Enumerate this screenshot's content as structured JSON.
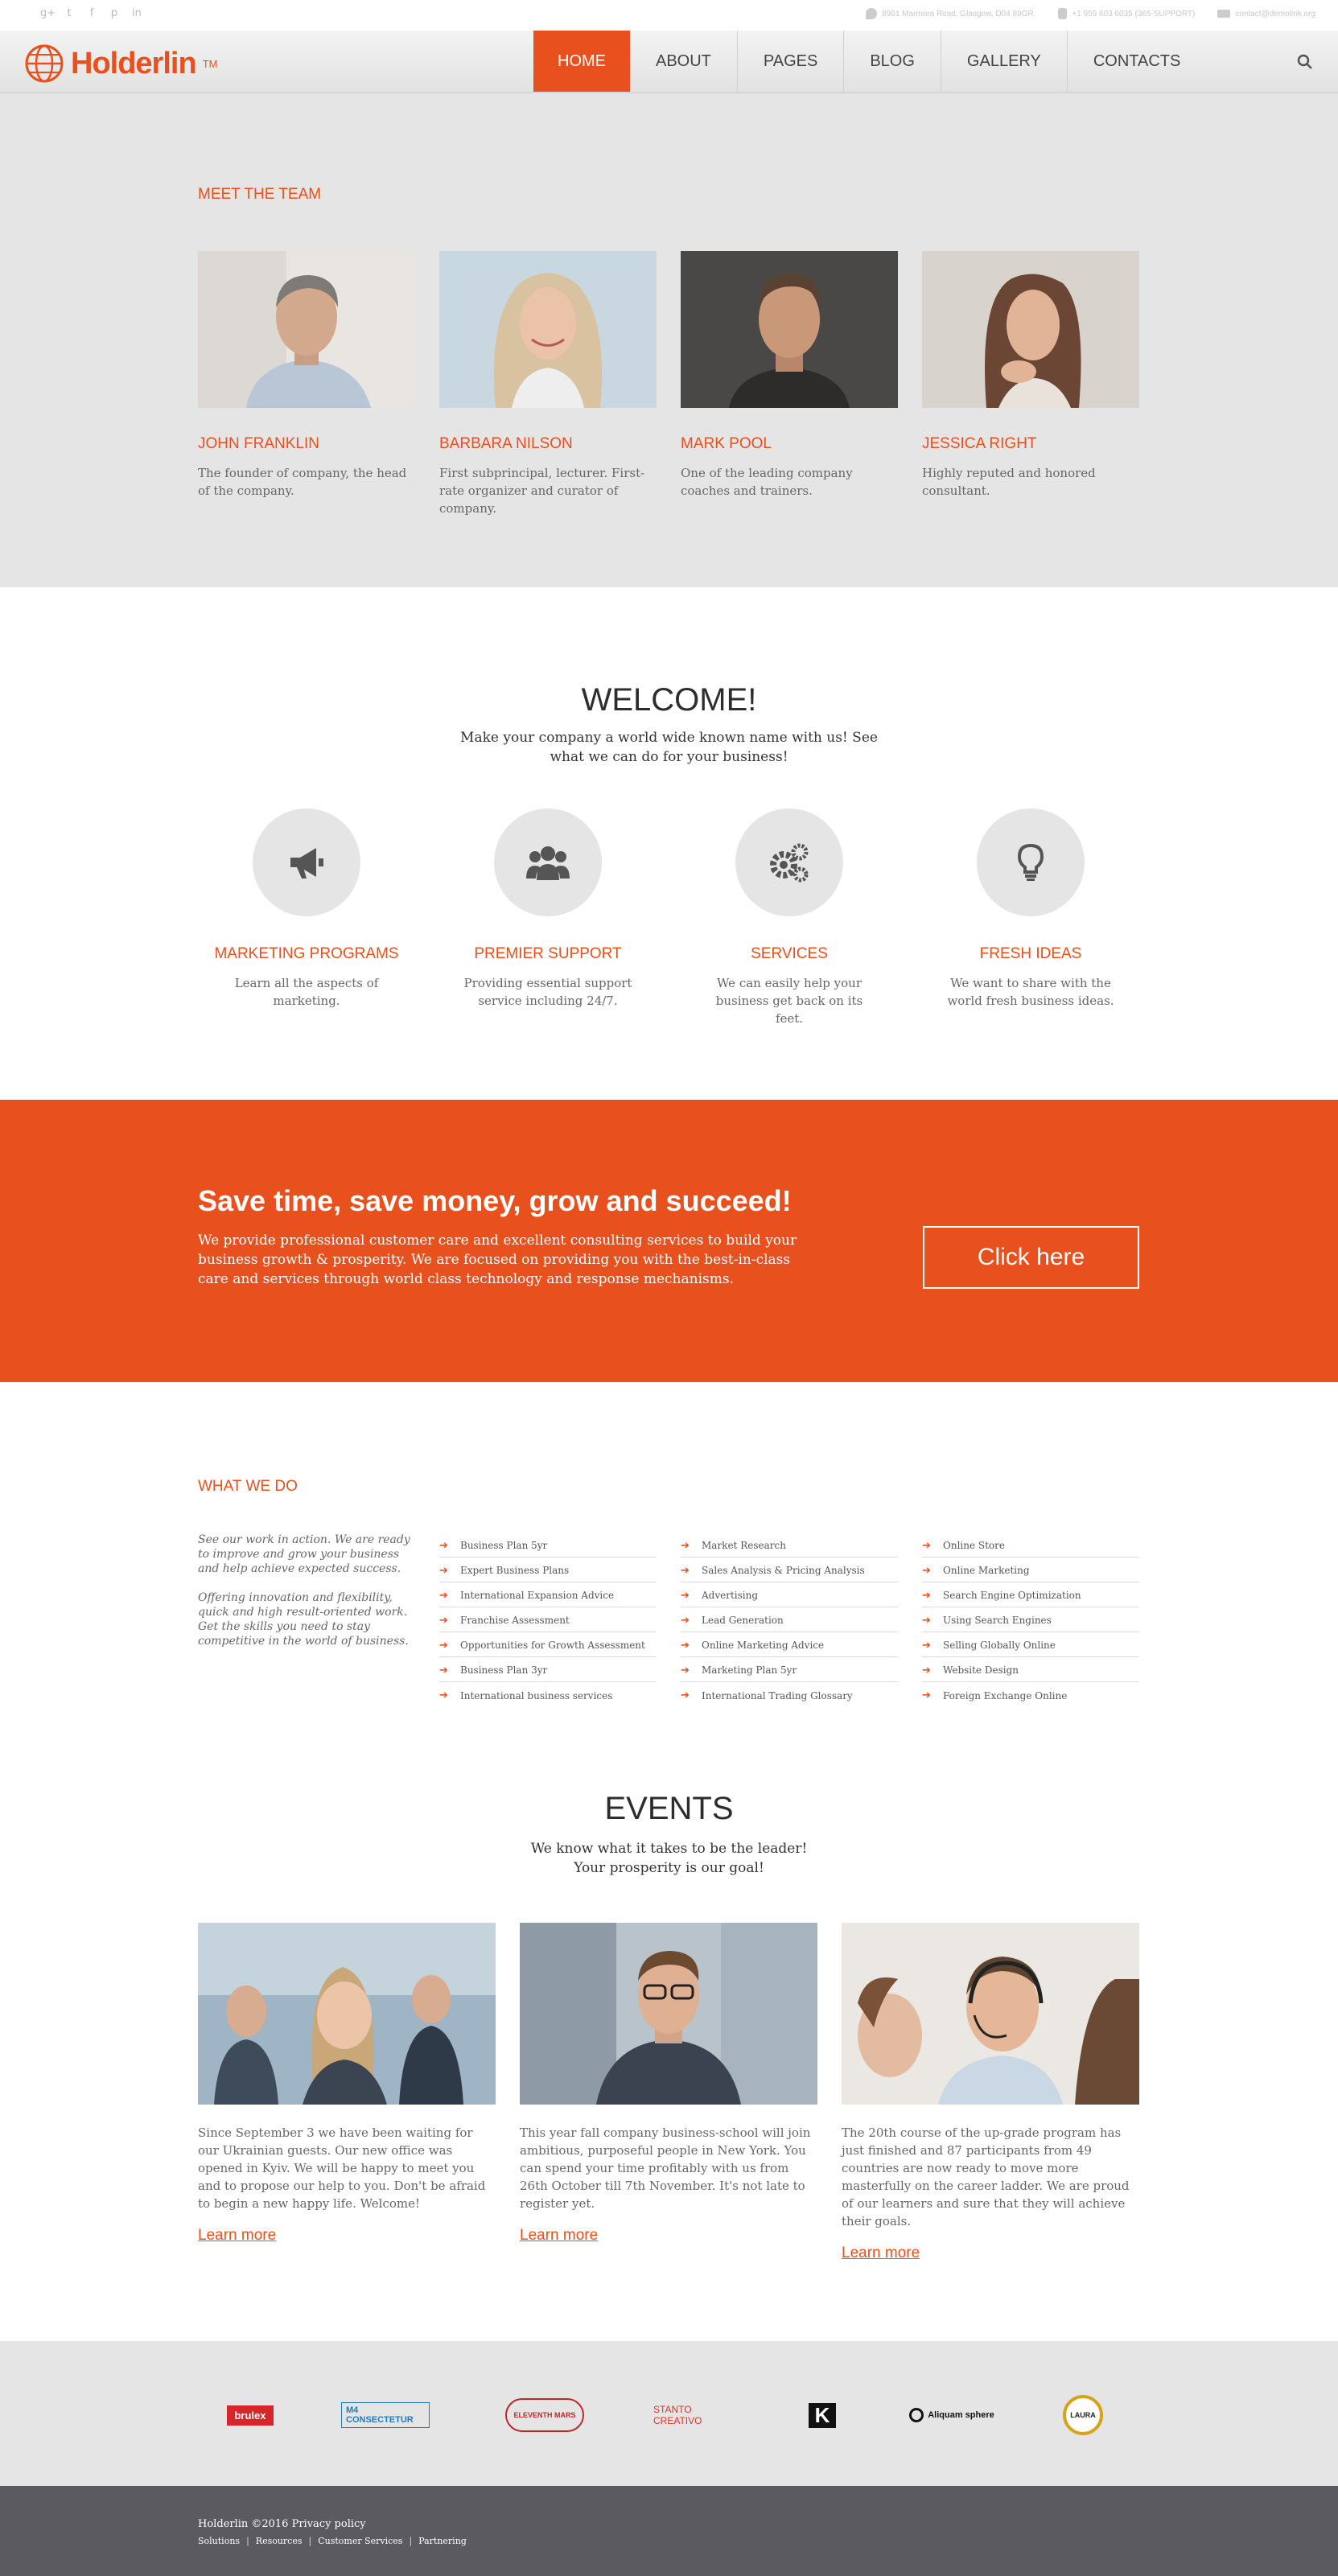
{
  "topbar": {
    "social_icons": [
      "google-plus-icon",
      "twitter-icon",
      "facebook-icon",
      "pinterest-icon",
      "linkedin-icon"
    ],
    "address": "8901 Marmora Road, Glasgow, D04 89GR.",
    "phone": "+1 959 603 6035 (365-SUPPORT)",
    "email": "contact@demolink.org"
  },
  "header": {
    "logo_text": "Holderlin",
    "logo_tm": "TM",
    "nav": [
      "HOME",
      "ABOUT",
      "PAGES",
      "BLOG",
      "GALLERY",
      "CONTACTS"
    ],
    "active_nav": "HOME"
  },
  "team": {
    "label": "MEET THE TEAM",
    "members": [
      {
        "name": "JOHN FRANKLIN",
        "desc": "The founder of company, the head of the company."
      },
      {
        "name": "BARBARA NILSON",
        "desc": "First subprincipal, lecturer. First-rate organizer and curator of company."
      },
      {
        "name": "MARK POOL",
        "desc": "One of the leading company coaches and trainers."
      },
      {
        "name": "JESSICA RIGHT",
        "desc": "Highly reputed and honored consultant."
      }
    ]
  },
  "welcome": {
    "title": "WELCOME!",
    "subtitle": "Make your company a world wide known name with us! See what we can do for your business!",
    "features": [
      {
        "icon": "megaphone-icon",
        "title": "MARKETING PROGRAMS",
        "desc": "Learn all the aspects of marketing."
      },
      {
        "icon": "users-icon",
        "title": "PREMIER SUPPORT",
        "desc": "Providing essential support service including 24/7."
      },
      {
        "icon": "gears-icon",
        "title": "SERVICES",
        "desc": "We can easily help your business get back on its feet."
      },
      {
        "icon": "lightbulb-icon",
        "title": "FRESH IDEAS",
        "desc": "We want to share with the world fresh business ideas."
      }
    ]
  },
  "cta": {
    "title": "Save time, save money, grow and succeed!",
    "text": "We provide professional customer care and excellent consulting services to build your business growth & prosperity. We are focused on providing you with the best-in-class care and services through world class technology and response mechanisms.",
    "button": "Click here"
  },
  "what_we_do": {
    "label": "WHAT WE DO",
    "intro": [
      "See our work in action. We are ready to improve and grow your business and help achieve expected success.",
      "Offering innovation and flexibility, quick and high result-oriented work. Get the skills you need to stay competitive in the world of business."
    ],
    "columns": [
      [
        "Business Plan 5yr",
        "Expert Business Plans",
        "International Expansion Advice",
        "Franchise Assessment",
        "Opportunities for Growth Assessment",
        "Business Plan 3yr",
        "International business services"
      ],
      [
        "Market Research",
        "Sales Analysis & Pricing Analysis",
        "Advertising",
        "Lead Generation",
        "Online Marketing Advice",
        "Marketing Plan 5yr",
        "International Trading Glossary"
      ],
      [
        "Online Store",
        "Online Marketing",
        "Search Engine Optimization",
        "Using Search Engines",
        "Selling Globally Online",
        "Website Design",
        "Foreign Exchange Online"
      ]
    ]
  },
  "events": {
    "title": "EVENTS",
    "subtitle_line1": "We know what it takes to be the leader!",
    "subtitle_line2": "Your prosperity is our goal!",
    "items": [
      {
        "text": "Since September 3 we have been waiting for our Ukrainian guests. Our new office was opened in Kyiv. We will be happy to meet you and to propose our help to you. Don't be afraid to begin a new happy life. Welcome!",
        "link": "Learn more"
      },
      {
        "text": "This year fall company business-school will join ambitious, purposeful people in New York. You can spend your time profitably with us from 26th October till 7th November. It's not late to register yet.",
        "link": "Learn more"
      },
      {
        "text": "The 20th course of the up-grade program has just finished and 87 participants from 49 countries are now ready to move more masterfully on the career ladder. We are proud of our learners and sure that they will achieve their goals.",
        "link": "Learn more"
      }
    ]
  },
  "partners": [
    "brulex",
    "M4 CONSECTETUR",
    "ELEVENTH MARS",
    "STANTO CREATIVO",
    "K",
    "Aliquam sphere",
    "LAURA"
  ],
  "footer": {
    "copyright": "Holderlin ©2016 Privacy policy",
    "links": [
      "Solutions",
      "Resources",
      "Customer Services",
      "Partnering"
    ]
  },
  "colors": {
    "accent": "#e8501d",
    "gray_bg": "#e5e5e5",
    "footer_bg": "#5b5a60"
  }
}
